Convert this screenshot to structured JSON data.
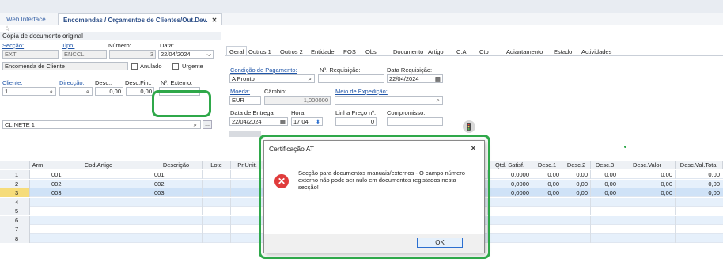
{
  "tabs": {
    "inactive": "Web Interface",
    "active": "Encomendas / Orçamentos de Clientes/Out.Dev.",
    "close": "✕"
  },
  "doc": {
    "section_title": "Cópia de documento original",
    "labels": {
      "seccao": "Secção:",
      "tipo": "Tipo:",
      "numero": "Número:",
      "data": "Data:",
      "cliente": "Cliente:",
      "direccao": "Direcção:",
      "desc": "Desc.:",
      "descfin": "Desc.Fin.:",
      "nexterno": "Nº. Externo:",
      "anulado": "Anulado",
      "urgente": "Urgente"
    },
    "seccao": "EXT",
    "tipo": "ENCCL",
    "numero": "3",
    "data": "22/04/2024",
    "doc_name": "Encomenda de Cliente",
    "cliente": "1",
    "desc": "0,00",
    "descfin": "0,00",
    "nexterno": "",
    "cliente_nome": "CLINETE 1"
  },
  "gtabs": [
    "Geral",
    "Outros 1",
    "Outros 2",
    "Entidade",
    "POS",
    "Obs",
    "Documento",
    "Artigo",
    "C.A.",
    "Ctb",
    "Adiantamento",
    "Estado",
    "Actividades"
  ],
  "geral": {
    "labels": {
      "condpag": "Condição de Pagamento:",
      "nreq": "Nº. Requisição:",
      "datareq": "Data Requisição:",
      "moeda": "Moeda:",
      "cambio": "Câmbio:",
      "meioexp": "Meio de Expedição:",
      "dataent": "Data de Entrega:",
      "hora": "Hora:",
      "linhapreco": "Linha Preço nº:",
      "compromisso": "Compromisso:"
    },
    "condpag": "A Pronto",
    "datareq": "22/04/2024",
    "moeda": "EUR",
    "cambio": "1,000000",
    "dataent": "22/04/2024",
    "hora": "17:04",
    "linhapreco": "0"
  },
  "grid": {
    "headers": [
      "Arm.",
      "Cod.Artigo",
      "Descrição",
      "Lote",
      "Pr.Unit.",
      "Qtd. Satisf.",
      "Desc.1",
      "Desc.2",
      "Desc.3",
      "Desc.Valor",
      "Desc.Val.Total"
    ],
    "rows": [
      {
        "n": "1",
        "cod": "001",
        "descr": "001",
        "qs": "0,0000",
        "d1": "0,00",
        "d2": "0,00",
        "d3": "0,00",
        "dv": "0,00",
        "dvt": "0,00"
      },
      {
        "n": "2",
        "cod": "002",
        "descr": "002",
        "qs": "0,0000",
        "d1": "0,00",
        "d2": "0,00",
        "d3": "0,00",
        "dv": "0,00",
        "dvt": "0,00"
      },
      {
        "n": "3",
        "cod": "003",
        "descr": "003",
        "qs": "0,0000",
        "d1": "0,00",
        "d2": "0,00",
        "d3": "0,00",
        "dv": "0,00",
        "dvt": "0,00"
      },
      {
        "n": "4"
      },
      {
        "n": "5"
      },
      {
        "n": "6"
      },
      {
        "n": "7"
      },
      {
        "n": "8"
      }
    ]
  },
  "dialog": {
    "title": "Certificação AT",
    "close": "✕",
    "message": "Secção para documentos manuais/externos - O campo número externo não pode ser nulo em documentos registados nesta secção!",
    "ok": "OK"
  },
  "colors": {
    "highlight": "#2fa84a",
    "error": "#e03c3c",
    "link": "#1f55a8"
  }
}
